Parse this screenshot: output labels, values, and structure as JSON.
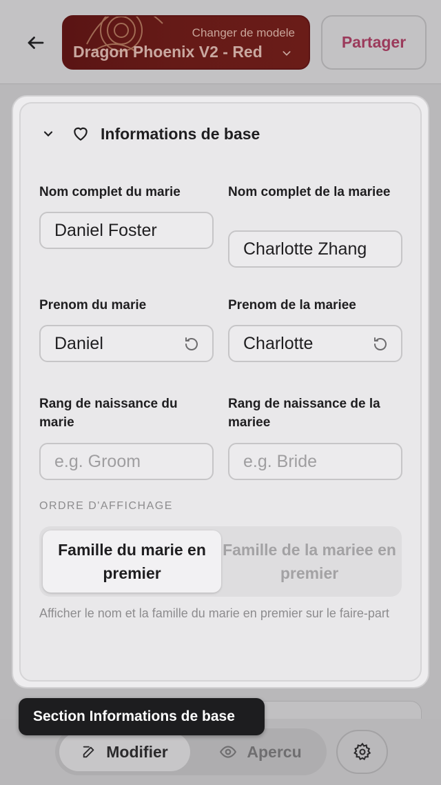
{
  "header": {
    "template_hint": "Changer de modele",
    "template_name": "Dragon Phoenix V2 - Red",
    "share_label": "Partager"
  },
  "section": {
    "title": "Informations de base",
    "groom_full_name_label": "Nom complet du marie",
    "groom_full_name_value": "Daniel Foster",
    "bride_full_name_label": "Nom complet de la mariee",
    "bride_full_name_value": "Charlotte Zhang",
    "groom_first_name_label": "Prenom du marie",
    "groom_first_name_value": "Daniel",
    "bride_first_name_label": "Prenom de la mariee",
    "bride_first_name_value": "Charlotte",
    "groom_birth_rank_label": "Rang de naissance du marie",
    "groom_birth_rank_placeholder": "e.g. Groom",
    "bride_birth_rank_label": "Rang de naissance de la mariee",
    "bride_birth_rank_placeholder": "e.g. Bride",
    "display_order_label": "ORDRE D'AFFICHAGE",
    "order_option_groom": "Famille du marie en premier",
    "order_option_bride": "Famille de la mariee en premier",
    "order_help": "Afficher le nom et la famille du marie en premier sur le faire-part"
  },
  "tooltip": "Section Informations de base",
  "bottom": {
    "modify_label": "Modifier",
    "preview_label": "Apercu"
  },
  "icons": {
    "back": "arrow-left-icon",
    "template_dropdown": "chevron-down-icon",
    "collapse": "chevron-down-icon",
    "section": "heart-icon",
    "reset": "reset-icon",
    "modify": "edit-icon",
    "preview": "eye-icon",
    "settings": "gear-icon"
  },
  "colors": {
    "template_bg": "#651a17",
    "share_text": "#9b3a5b",
    "tooltip_bg": "#1d1d1f"
  }
}
